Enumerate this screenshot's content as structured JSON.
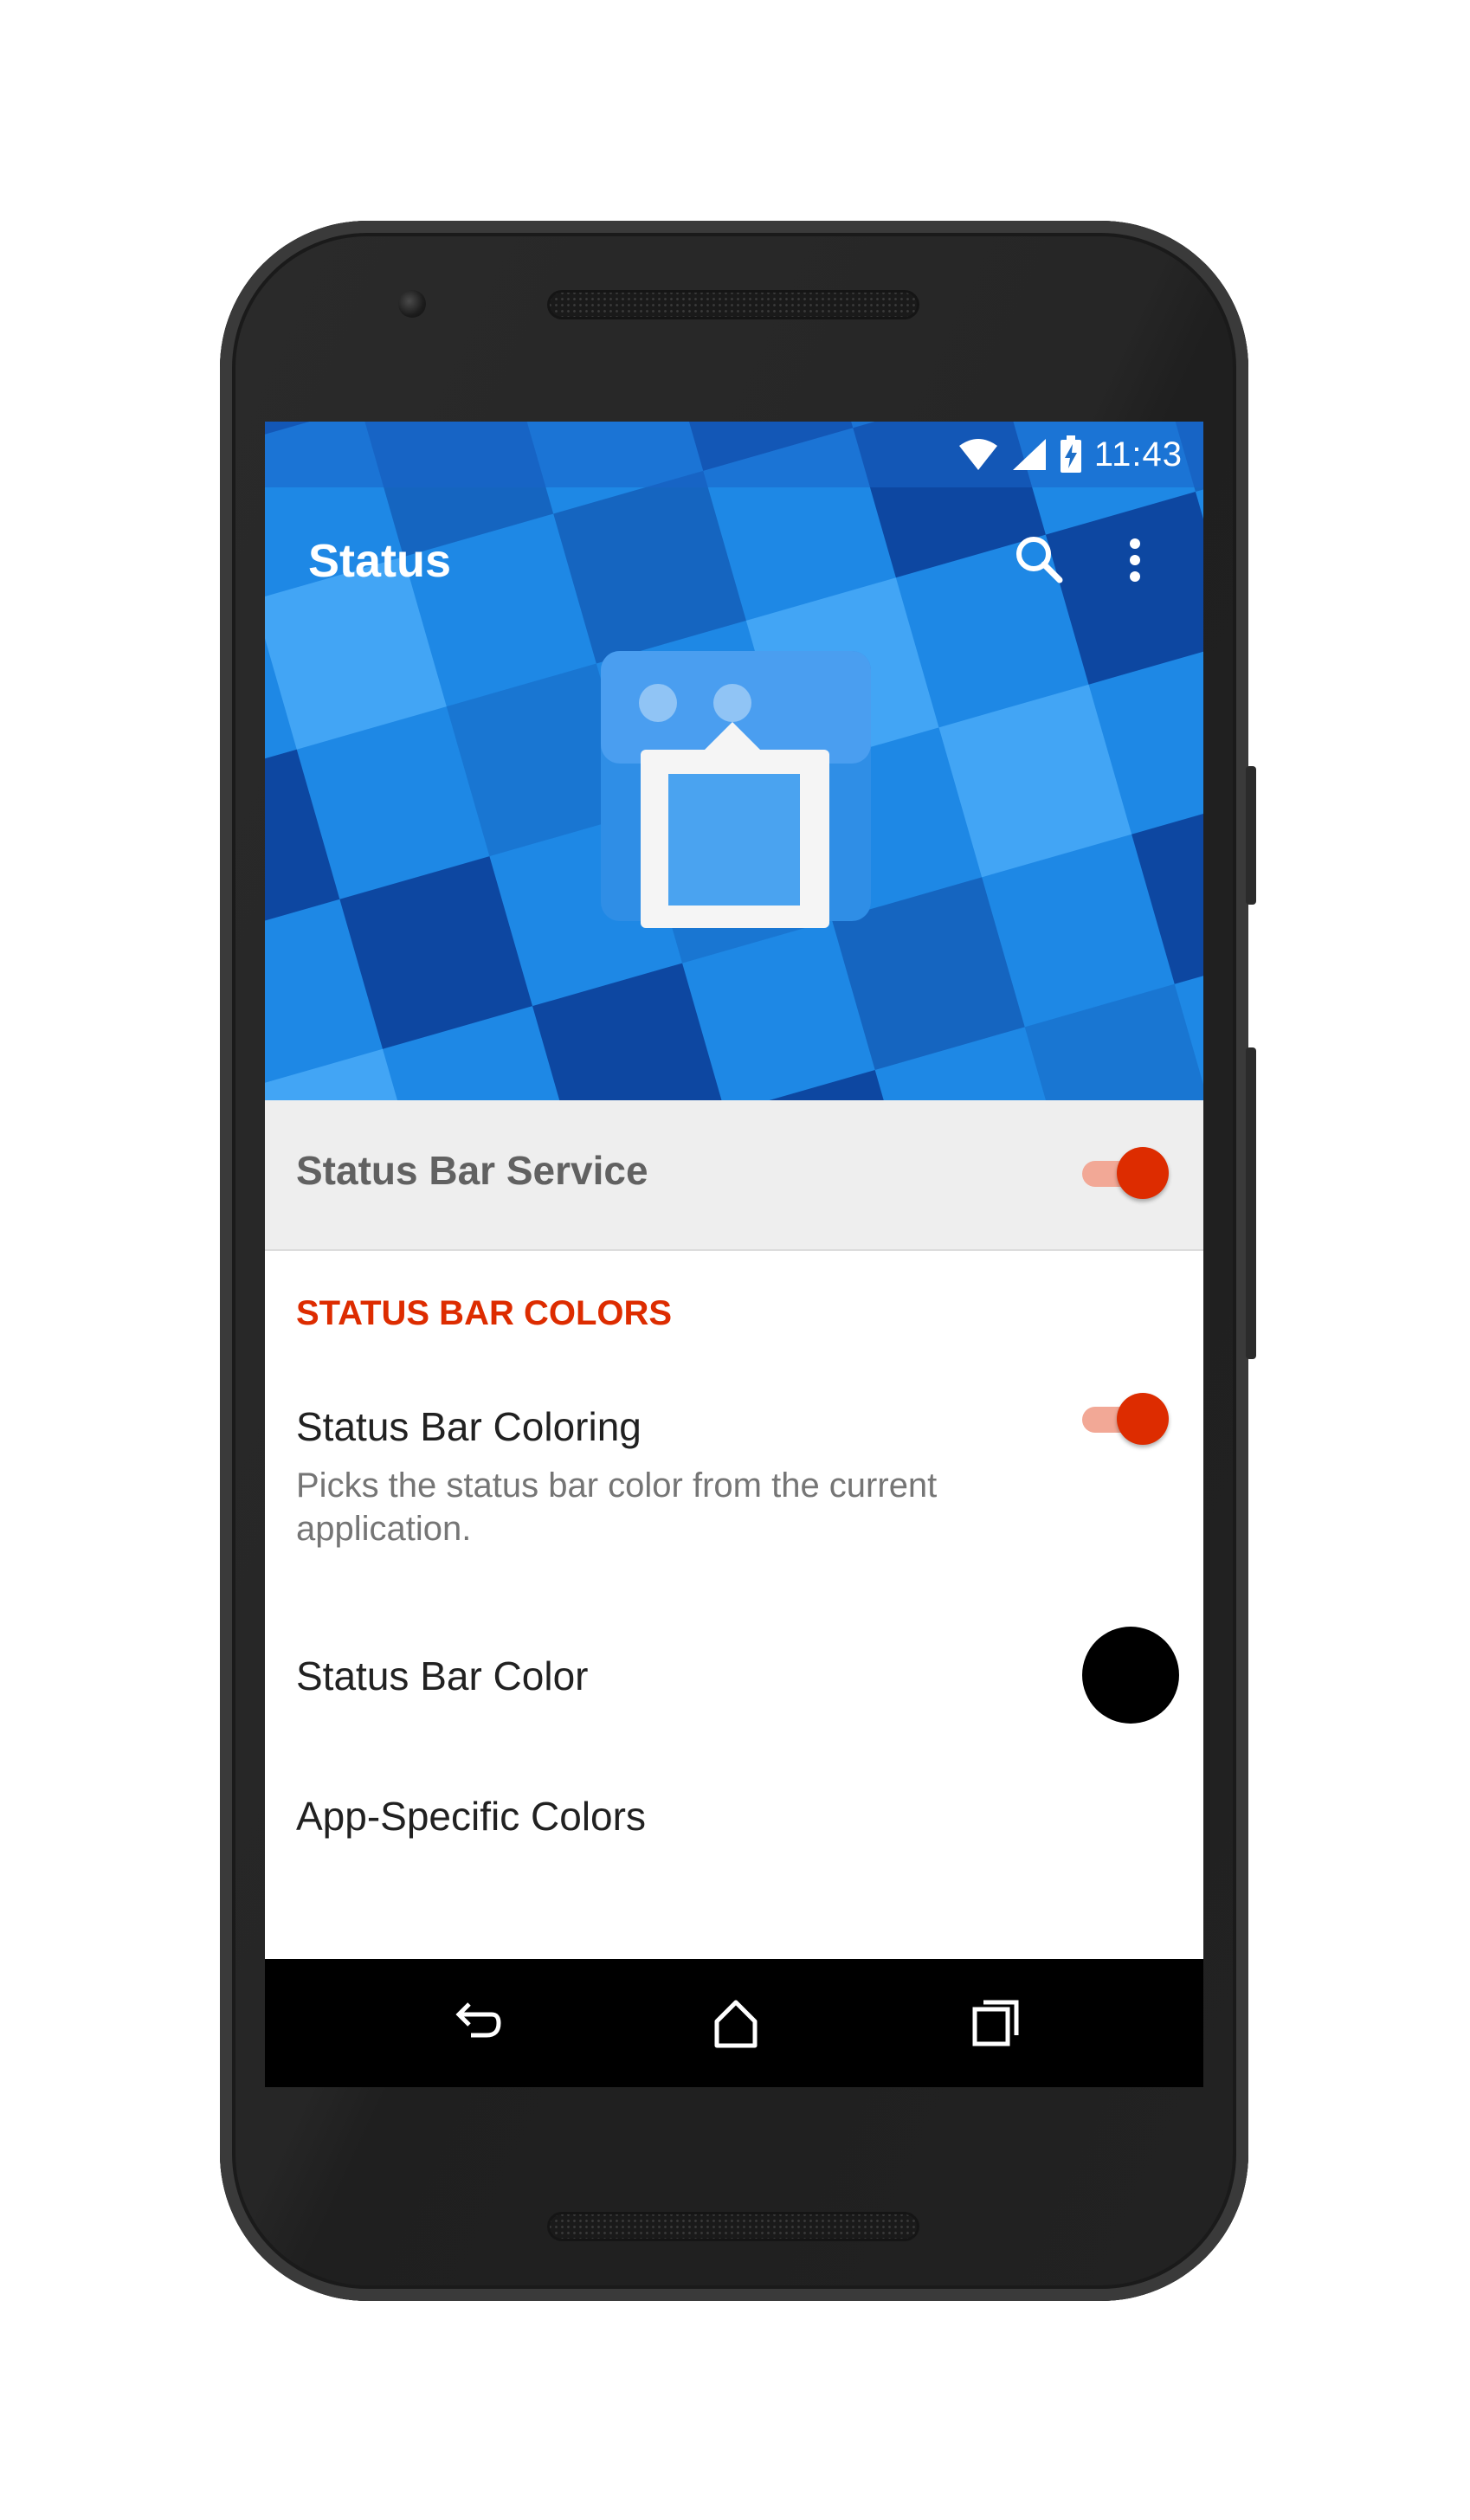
{
  "status_bar": {
    "time": "11:43"
  },
  "toolbar": {
    "title": "Status",
    "search_icon": "search-icon",
    "more_icon": "more-vert-icon"
  },
  "service": {
    "label": "Status Bar Service",
    "enabled": true
  },
  "section": {
    "header": "STATUS BAR COLORS"
  },
  "preferences": [
    {
      "title": "Status Bar Coloring",
      "summary": "Picks the status bar color from the current application.",
      "enabled": true
    },
    {
      "title": "Status Bar Color",
      "color": "#000000"
    },
    {
      "title": "App-Specific Colors"
    }
  ],
  "nav_bar": {
    "icons": [
      "back-icon",
      "home-icon",
      "recents-icon"
    ]
  },
  "colors": {
    "primary": "#1e88e5",
    "accent": "#dd2c00",
    "switch_track": "#f2a896",
    "service_row_bg": "#eeeeee"
  }
}
